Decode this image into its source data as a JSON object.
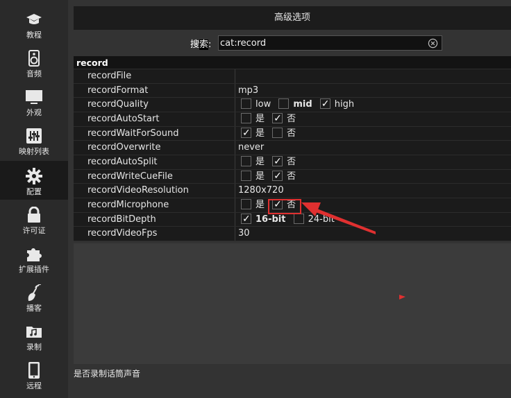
{
  "sidebar": {
    "items": [
      {
        "label": "教程",
        "icon": "graduation-cap-icon"
      },
      {
        "label": "音频",
        "icon": "speaker-icon"
      },
      {
        "label": "外观",
        "icon": "monitor-icon"
      },
      {
        "label": "映射列表",
        "icon": "sliders-icon"
      },
      {
        "label": "配置",
        "icon": "gear-icon",
        "active": true
      },
      {
        "label": "许可证",
        "icon": "lock-icon"
      },
      {
        "label": "扩展插件",
        "icon": "puzzle-icon"
      },
      {
        "label": "播客",
        "icon": "podcast-icon"
      },
      {
        "label": "录制",
        "icon": "music-folder-icon"
      },
      {
        "label": "远程",
        "icon": "tablet-icon"
      }
    ]
  },
  "header": {
    "title": "高级选项"
  },
  "search": {
    "label_prefix": "搜",
    "label_highlight": "索",
    "label_suffix": ":",
    "value": "cat:record"
  },
  "table": {
    "group": "record",
    "rows": {
      "recordFile": {
        "key": "recordFile",
        "value": ""
      },
      "recordFormat": {
        "key": "recordFormat",
        "value": "mp3"
      },
      "recordQuality": {
        "key": "recordQuality",
        "options": [
          {
            "label": "low",
            "checked": false
          },
          {
            "label": "mid",
            "checked": false
          },
          {
            "label": "high",
            "checked": true
          }
        ]
      },
      "recordAutoStart": {
        "key": "recordAutoStart",
        "yes": "是",
        "no": "否",
        "yes_checked": false,
        "no_checked": true
      },
      "recordWaitForSound": {
        "key": "recordWaitForSound",
        "yes": "是",
        "no": "否",
        "yes_checked": true,
        "no_checked": false
      },
      "recordOverwrite": {
        "key": "recordOverwrite",
        "value": "never"
      },
      "recordAutoSplit": {
        "key": "recordAutoSplit",
        "yes": "是",
        "no": "否",
        "yes_checked": false,
        "no_checked": true
      },
      "recordWriteCueFile": {
        "key": "recordWriteCueFile",
        "yes": "是",
        "no": "否",
        "yes_checked": false,
        "no_checked": true
      },
      "recordVideoResolution": {
        "key": "recordVideoResolution",
        "value": "1280x720"
      },
      "recordMicrophone": {
        "key": "recordMicrophone",
        "yes": "是",
        "no": "否",
        "yes_checked": false,
        "no_checked": true
      },
      "recordBitDepth": {
        "key": "recordBitDepth",
        "options": [
          {
            "label": "16-bit",
            "checked": true
          },
          {
            "label": "24-bit",
            "checked": false
          }
        ]
      },
      "recordVideoFps": {
        "key": "recordVideoFps",
        "value": "30"
      }
    }
  },
  "status": {
    "text": "是否录制话筒声音"
  },
  "colors": {
    "annotation": "#e03030",
    "sidebar_bg": "#2a2a2a",
    "table_bg": "#1b1b1b",
    "title_bg": "#1c1c1c"
  }
}
